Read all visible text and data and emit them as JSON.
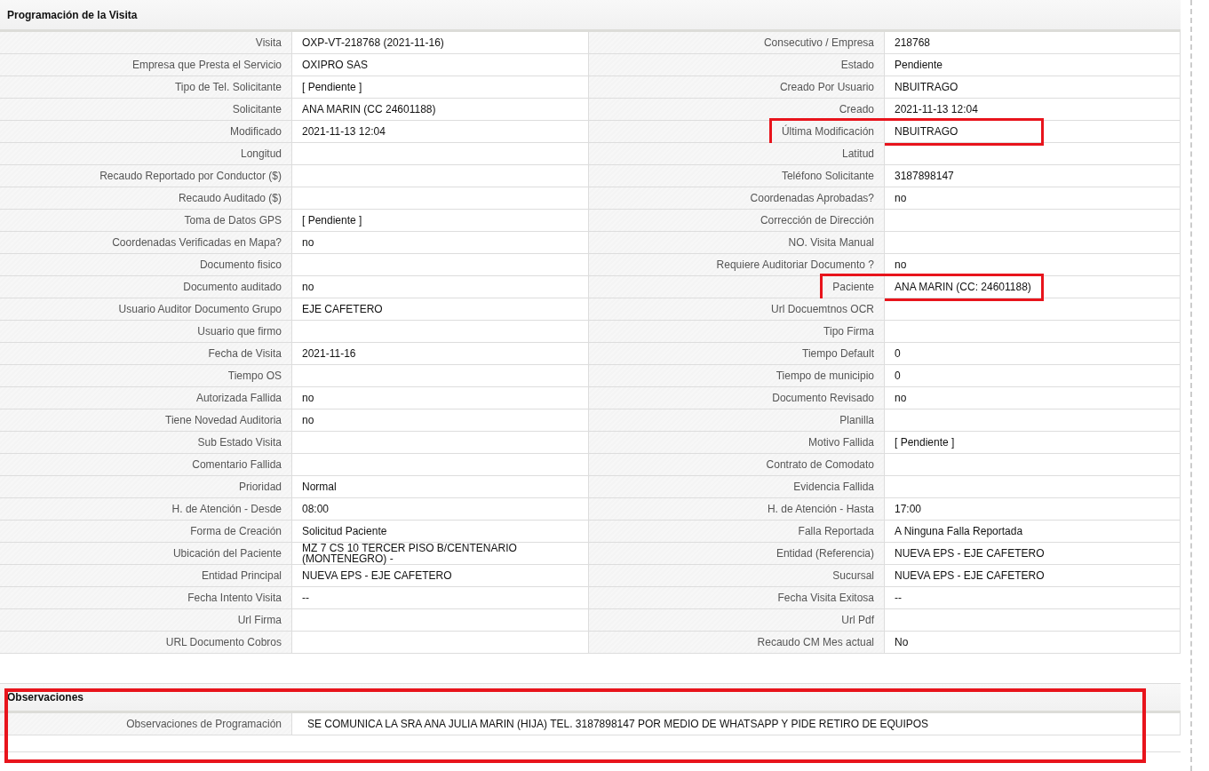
{
  "sections": [
    {
      "title": "Programación de la Visita",
      "highlighted": false,
      "rows": [
        [
          {
            "label": "Visita",
            "value": "OXP-VT-218768 (2021-11-16)",
            "highlighted": false
          },
          {
            "label": "Consecutivo / Empresa",
            "value": "218768",
            "highlighted": false
          }
        ],
        [
          {
            "label": "Empresa que Presta el Servicio",
            "value": "OXIPRO SAS",
            "highlighted": false
          },
          {
            "label": "Estado",
            "value": "Pendiente",
            "highlighted": false
          }
        ],
        [
          {
            "label": "Tipo de Tel. Solicitante",
            "value": "[ Pendiente ]",
            "highlighted": false
          },
          {
            "label": "Creado Por Usuario",
            "value": "NBUITRAGO",
            "highlighted": false
          }
        ],
        [
          {
            "label": "Solicitante",
            "value": "ANA MARIN (CC 24601188)",
            "highlighted": false
          },
          {
            "label": "Creado",
            "value": "2021-11-13 12:04",
            "highlighted": false
          }
        ],
        [
          {
            "label": "Modificado",
            "value": "2021-11-13 12:04",
            "highlighted": false
          },
          {
            "label": "Última Modificación",
            "value": "NBUITRAGO",
            "highlighted": true
          }
        ],
        [
          {
            "label": "Longitud",
            "highlighted": false
          },
          {
            "label": "Latitud",
            "highlighted": false
          }
        ],
        [
          {
            "label": "Recaudo Reportado por Conductor ($)",
            "highlighted": false
          },
          {
            "label": "Teléfono Solicitante",
            "value": "3187898147",
            "highlighted": false
          }
        ],
        [
          {
            "label": "Recaudo Auditado ($)",
            "highlighted": false
          },
          {
            "label": "Coordenadas Aprobadas?",
            "value": "no",
            "highlighted": false
          }
        ],
        [
          {
            "label": "Toma de Datos GPS",
            "value": "[ Pendiente ]",
            "highlighted": false
          },
          {
            "label": "Corrección de Dirección",
            "highlighted": false
          }
        ],
        [
          {
            "label": "Coordenadas Verificadas en Mapa?",
            "value": "no",
            "highlighted": false
          },
          {
            "label": "NO. Visita Manual",
            "highlighted": false
          }
        ],
        [
          {
            "label": "Documento fisico",
            "highlighted": false
          },
          {
            "label": "Requiere Auditoriar Documento ?",
            "value": "no",
            "highlighted": false
          }
        ],
        [
          {
            "label": "Documento auditado",
            "value": "no",
            "highlighted": false
          },
          {
            "label": "Paciente",
            "value": "ANA MARIN (CC: 24601188)",
            "highlighted": true
          }
        ],
        [
          {
            "label": "Usuario Auditor Documento Grupo",
            "value": "EJE CAFETERO",
            "highlighted": false
          },
          {
            "label": "Url Docuemtnos OCR",
            "highlighted": false
          }
        ],
        [
          {
            "label": "Usuario que firmo",
            "highlighted": false
          },
          {
            "label": "Tipo Firma",
            "highlighted": false
          }
        ],
        [
          {
            "label": "Fecha de Visita",
            "value": "2021-11-16",
            "highlighted": false
          },
          {
            "label": "Tiempo Default",
            "value": "0",
            "highlighted": false
          }
        ],
        [
          {
            "label": "Tiempo OS",
            "highlighted": false
          },
          {
            "label": "Tiempo de municipio",
            "value": "0",
            "highlighted": false
          }
        ],
        [
          {
            "label": "Autorizada Fallida",
            "value": "no",
            "highlighted": false
          },
          {
            "label": "Documento Revisado",
            "value": "no",
            "highlighted": false
          }
        ],
        [
          {
            "label": "Tiene Novedad Auditoria",
            "value": "no",
            "highlighted": false
          },
          {
            "label": "Planilla",
            "highlighted": false
          }
        ],
        [
          {
            "label": "Sub Estado Visita",
            "highlighted": false
          },
          {
            "label": "Motivo Fallida",
            "value": "[ Pendiente ]",
            "highlighted": false
          }
        ],
        [
          {
            "label": "Comentario Fallida",
            "highlighted": false
          },
          {
            "label": "Contrato de Comodato",
            "highlighted": false
          }
        ],
        [
          {
            "label": "Prioridad",
            "value": "Normal",
            "highlighted": false
          },
          {
            "label": "Evidencia Fallida",
            "highlighted": false
          }
        ],
        [
          {
            "label": "H. de Atención - Desde",
            "value": "08:00",
            "highlighted": false
          },
          {
            "label": "H. de Atención - Hasta",
            "value": "17:00",
            "highlighted": false
          }
        ],
        [
          {
            "label": "Forma de Creación",
            "value": "Solicitud Paciente",
            "highlighted": false
          },
          {
            "label": "Falla Reportada",
            "value": "A Ninguna Falla Reportada",
            "highlighted": false
          }
        ],
        [
          {
            "label": "Ubicación del Paciente",
            "value": "MZ 7 CS 10 TERCER PISO B/CENTENARIO (MONTENEGRO) -",
            "highlighted": false
          },
          {
            "label": "Entidad (Referencia)",
            "value": "NUEVA EPS - EJE CAFETERO",
            "highlighted": false
          }
        ],
        [
          {
            "label": "Entidad Principal",
            "value": "NUEVA EPS - EJE CAFETERO",
            "highlighted": false
          },
          {
            "label": "Sucursal",
            "value": "NUEVA EPS - EJE CAFETERO",
            "highlighted": false
          }
        ],
        [
          {
            "label": "Fecha Intento Visita",
            "value": "--",
            "highlighted": false
          },
          {
            "label": "Fecha Visita Exitosa",
            "value": "--",
            "highlighted": false
          }
        ],
        [
          {
            "label": "Url Firma",
            "highlighted": false
          },
          {
            "label": "Url Pdf",
            "highlighted": false
          }
        ],
        [
          {
            "label": "URL Documento Cobros",
            "highlighted": false
          },
          {
            "label": "Recaudo CM Mes actual",
            "value": "No",
            "highlighted": false
          }
        ]
      ]
    },
    {
      "title": "Observaciones",
      "highlighted": true,
      "rows": [
        [
          {
            "label": "Observaciones de Programación",
            "value": "SE COMUNICA LA SRA ANA JULIA MARIN (HIJA) TEL. 3187898147 POR MEDIO DE WHATSAPP Y PIDE RETIRO DE EQUIPOS",
            "highlighted": false
          }
        ]
      ]
    }
  ]
}
